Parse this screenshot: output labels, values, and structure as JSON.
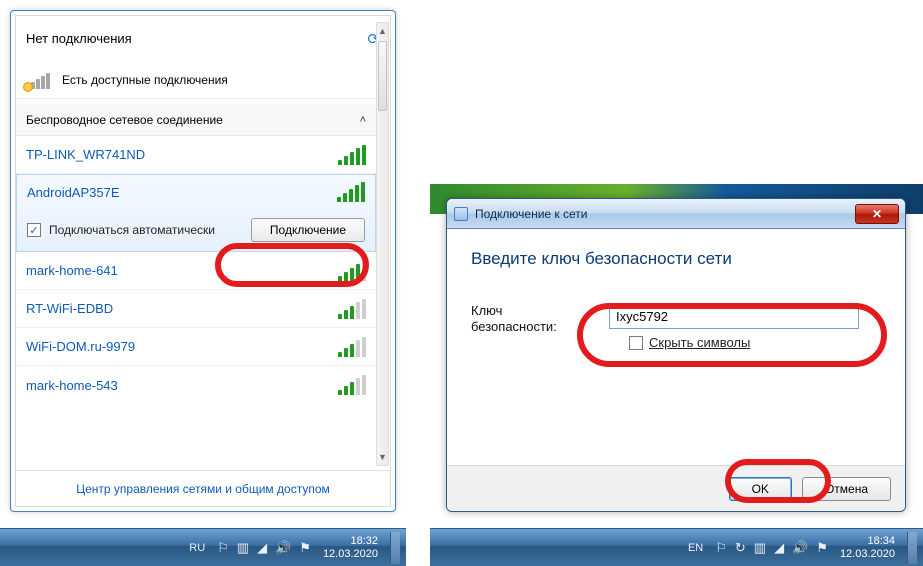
{
  "flyout": {
    "title": "Нет подключения",
    "available_text": "Есть доступные подключения",
    "section_label": "Беспроводное сетевое соединение",
    "auto_connect_label": "Подключаться автоматически",
    "connect_button": "Подключение",
    "footer_link": "Центр управления сетями и общим доступом",
    "networks": [
      {
        "name": "TP-LINK_WR741ND",
        "strength": 5
      },
      {
        "name": "AndroidAP357E",
        "strength": 5
      },
      {
        "name": "mark-home-641",
        "strength": 4
      },
      {
        "name": "RT-WiFi-EDBD",
        "strength": 3
      },
      {
        "name": "WiFi-DOM.ru-9979",
        "strength": 3
      },
      {
        "name": "mark-home-543",
        "strength": 3
      }
    ],
    "selected_index": 1
  },
  "dialog": {
    "window_title": "Подключение к сети",
    "heading": "Введите ключ безопасности сети",
    "field_label": "Ключ безопасности:",
    "field_value": "Ixyc5792",
    "hide_chars_label": "Скрыть символы",
    "ok": "OK",
    "cancel": "Отмена"
  },
  "taskbar_a": {
    "lang": "RU",
    "time": "18:32",
    "date": "12.03.2020"
  },
  "taskbar_b": {
    "lang": "EN",
    "time": "18:34",
    "date": "12.03.2020"
  }
}
